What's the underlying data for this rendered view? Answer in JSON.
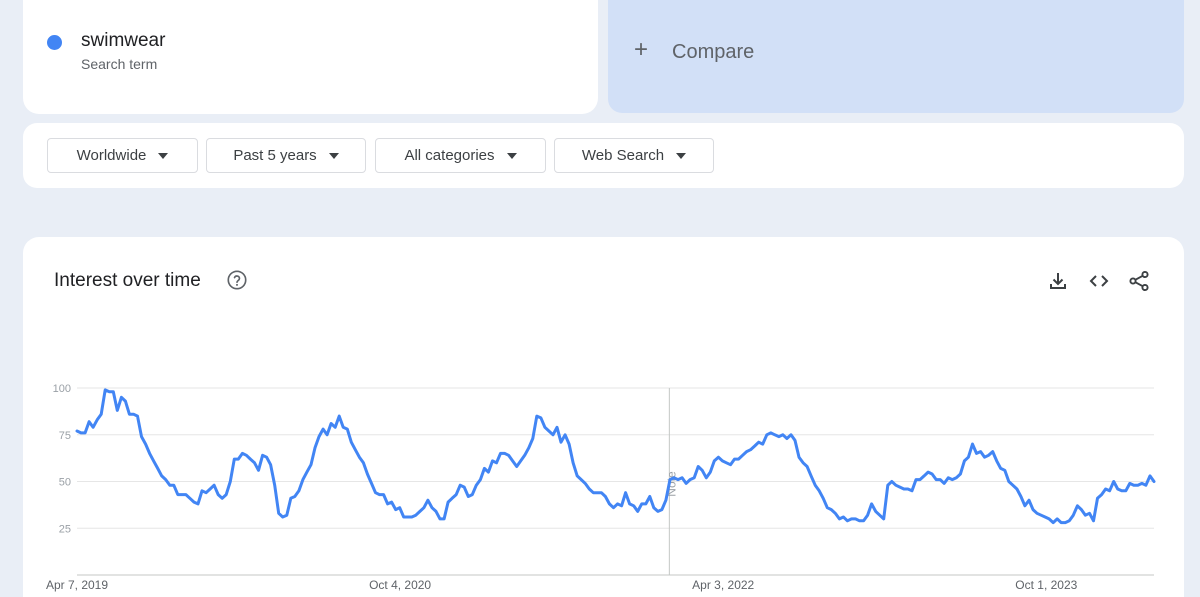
{
  "search_term": {
    "name": "swimwear",
    "subtitle": "Search term",
    "color": "#4285f4"
  },
  "compare": {
    "label": "Compare",
    "icon": "plus-icon"
  },
  "filters": [
    {
      "label": "Worldwide",
      "icon": "caret-down-icon"
    },
    {
      "label": "Past 5 years",
      "icon": "caret-down-icon"
    },
    {
      "label": "All categories",
      "icon": "caret-down-icon"
    },
    {
      "label": "Web Search",
      "icon": "caret-down-icon"
    }
  ],
  "chart_card": {
    "title": "Interest over time",
    "help_icon": "help-circle-icon",
    "tools": [
      "download-icon",
      "embed-code-icon",
      "share-icon"
    ]
  },
  "chart_data": {
    "type": "line",
    "title": "Interest over time",
    "xlabel": "",
    "ylabel": "",
    "ylim": [
      0,
      100
    ],
    "yticks": [
      25,
      50,
      75,
      100
    ],
    "grid": true,
    "x_start": "2019-04-07",
    "x_end": "2024-03-31",
    "x_tick_labels": [
      {
        "label": "Apr 7, 2019",
        "date": "2019-04-07"
      },
      {
        "label": "Oct 4, 2020",
        "date": "2020-10-04"
      },
      {
        "label": "Apr 3, 2022",
        "date": "2022-04-03"
      },
      {
        "label": "Oct 1, 2023",
        "date": "2023-10-01"
      }
    ],
    "annotation": {
      "label": "Note",
      "date": "2022-01-02"
    },
    "series": [
      {
        "name": "swimwear",
        "color": "#4285f4",
        "values": [
          77,
          76,
          76,
          82,
          79,
          83,
          86,
          99,
          98,
          98,
          88,
          95,
          93,
          86,
          86,
          85,
          74,
          70,
          65,
          61,
          57,
          53,
          51,
          48,
          48,
          43,
          43,
          43,
          41,
          39,
          38,
          45,
          44,
          46,
          48,
          43,
          41,
          43,
          50,
          62,
          62,
          65,
          64,
          62,
          60,
          56,
          64,
          63,
          59,
          48,
          33,
          31,
          32,
          41,
          42,
          45,
          51,
          55,
          59,
          68,
          74,
          78,
          75,
          81,
          79,
          85,
          79,
          78,
          71,
          67,
          63,
          60,
          54,
          49,
          44,
          43,
          43,
          38,
          39,
          35,
          36,
          31,
          31,
          31,
          32,
          34,
          36,
          40,
          36,
          34,
          30,
          30,
          39,
          41,
          43,
          48,
          47,
          42,
          43,
          48,
          51,
          57,
          55,
          61,
          60,
          65,
          65,
          64,
          61,
          58,
          61,
          64,
          68,
          73,
          85,
          84,
          79,
          77,
          75,
          79,
          71,
          75,
          70,
          60,
          53,
          51,
          49,
          46,
          44,
          44,
          44,
          42,
          38,
          36,
          38,
          37,
          44,
          38,
          37,
          34,
          38,
          38,
          42,
          36,
          34,
          35,
          40,
          51,
          52,
          51,
          52,
          49,
          51,
          52,
          58,
          56,
          52,
          55,
          61,
          63,
          61,
          60,
          59,
          62,
          62,
          64,
          66,
          67,
          69,
          71,
          70,
          75,
          76,
          75,
          74,
          75,
          73,
          75,
          72,
          63,
          60,
          58,
          53,
          48,
          45,
          41,
          36,
          35,
          33,
          30,
          31,
          29,
          30,
          30,
          29,
          29,
          32,
          38,
          34,
          32,
          30,
          48,
          50,
          48,
          47,
          46,
          46,
          45,
          51,
          51,
          53,
          55,
          54,
          51,
          51,
          49,
          52,
          51,
          52,
          54,
          61,
          63,
          70,
          65,
          66,
          63,
          64,
          66,
          61,
          57,
          56,
          50,
          48,
          46,
          42,
          37,
          40,
          35,
          33,
          32,
          31,
          30,
          28,
          30,
          28,
          28,
          29,
          32,
          37,
          35,
          32,
          33,
          29,
          41,
          43,
          46,
          45,
          50,
          46,
          45,
          45,
          49,
          48,
          48,
          49,
          48,
          53,
          50
        ]
      }
    ]
  }
}
